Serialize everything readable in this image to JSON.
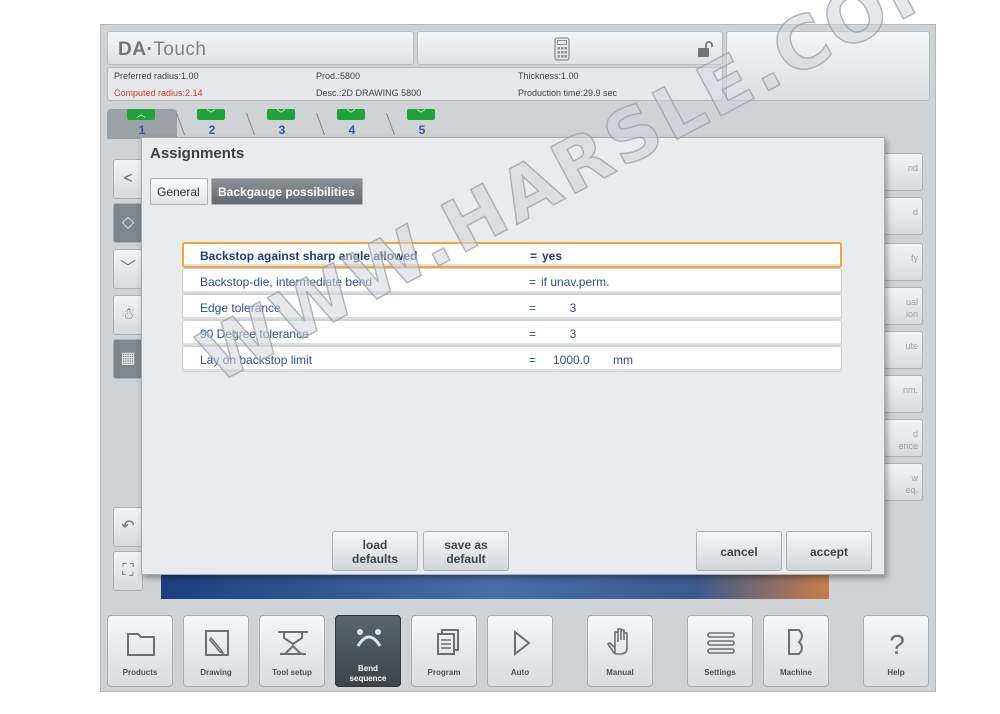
{
  "app": {
    "brand": "DA",
    "brand_suffix": "Touch"
  },
  "info": {
    "preferred_radius": "Preferred radius:1.00",
    "computed_radius": "Computed radius:2.14",
    "prod": "Prod.:5800",
    "desc": "Desc.:2D DRAWING 5800",
    "thickness": "Thickness:1.00",
    "production_time": "Production time:29.9 sec"
  },
  "bend_tabs": [
    "1",
    "2",
    "3",
    "4",
    "5"
  ],
  "right_column": [
    "nd",
    "d",
    "fy",
    "ual\nion",
    "ute",
    "nm.",
    "d\nence",
    "w\neq."
  ],
  "dialog": {
    "title": "Assignments",
    "tabs": {
      "general": "General",
      "backgauge": "Backgauge possibilities"
    },
    "rows": [
      {
        "label": "Backstop against sharp angle allowed",
        "eq": "=",
        "value": "yes",
        "unit": ""
      },
      {
        "label": "Backstop-die, intermediate bend",
        "eq": "=",
        "value": "if unav.perm.",
        "unit": ""
      },
      {
        "label": "Edge tolerance",
        "eq": "=",
        "value": "3",
        "unit": ""
      },
      {
        "label": "90 Degree tolerance",
        "eq": "=",
        "value": "3",
        "unit": ""
      },
      {
        "label": "Lay on backstop limit",
        "eq": "=",
        "value": "1000.0",
        "unit": "mm"
      }
    ],
    "buttons": {
      "load_defaults_1": "load",
      "load_defaults_2": "defaults",
      "save_default_1": "save as",
      "save_default_2": "default",
      "cancel": "cancel",
      "accept": "accept"
    }
  },
  "watermark": "WWW.HARSLE.COM",
  "toolbar": [
    {
      "label": "Products",
      "icon": "folder-icon"
    },
    {
      "label": "Drawing",
      "icon": "pencil-icon"
    },
    {
      "label": "Tool setup",
      "icon": "tool-icon"
    },
    {
      "label": "Bend sequence",
      "icon": "bend-icon"
    },
    {
      "label": "Program",
      "icon": "pages-icon"
    },
    {
      "label": "Auto",
      "icon": "play-icon"
    },
    {
      "label": "Manual",
      "icon": "hand-icon"
    },
    {
      "label": "Settings",
      "icon": "settings-icon"
    },
    {
      "label": "Machine",
      "icon": "machine-icon"
    },
    {
      "label": "Help",
      "icon": "help-icon"
    }
  ]
}
